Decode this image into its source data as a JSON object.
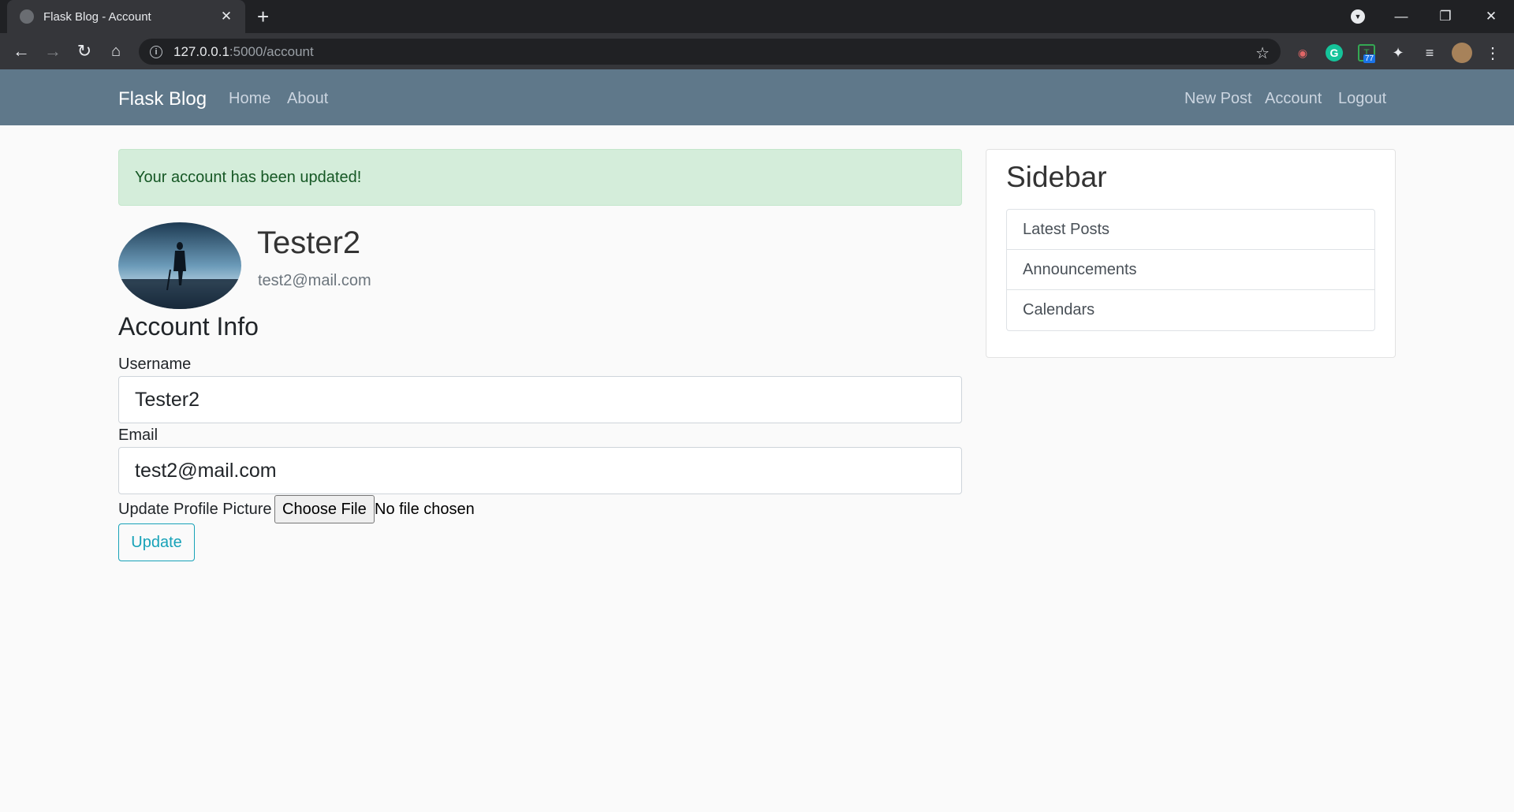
{
  "browser": {
    "tab_title": "Flask Blog - Account",
    "url_host": "127.0.0.1",
    "url_path": ":5000/account",
    "extension_badge": "77"
  },
  "navbar": {
    "brand": "Flask Blog",
    "left_links": [
      "Home",
      "About"
    ],
    "right_links": [
      "New Post",
      "Account",
      "Logout"
    ]
  },
  "alert": {
    "message": "Your account has been updated!",
    "color": "#d4edda"
  },
  "account": {
    "username": "Tester2",
    "email": "test2@mail.com"
  },
  "form": {
    "legend": "Account Info",
    "username_label": "Username",
    "username_value": "Tester2",
    "email_label": "Email",
    "email_value": "test2@mail.com",
    "picture_label": "Update Profile Picture",
    "file_button": "Choose File",
    "file_status": "No file chosen",
    "submit_label": "Update"
  },
  "sidebar": {
    "title": "Sidebar",
    "items": [
      "Latest Posts",
      "Announcements",
      "Calendars"
    ]
  },
  "colors": {
    "navbar_bg": "#5f788a",
    "accent": "#17a2b8"
  }
}
